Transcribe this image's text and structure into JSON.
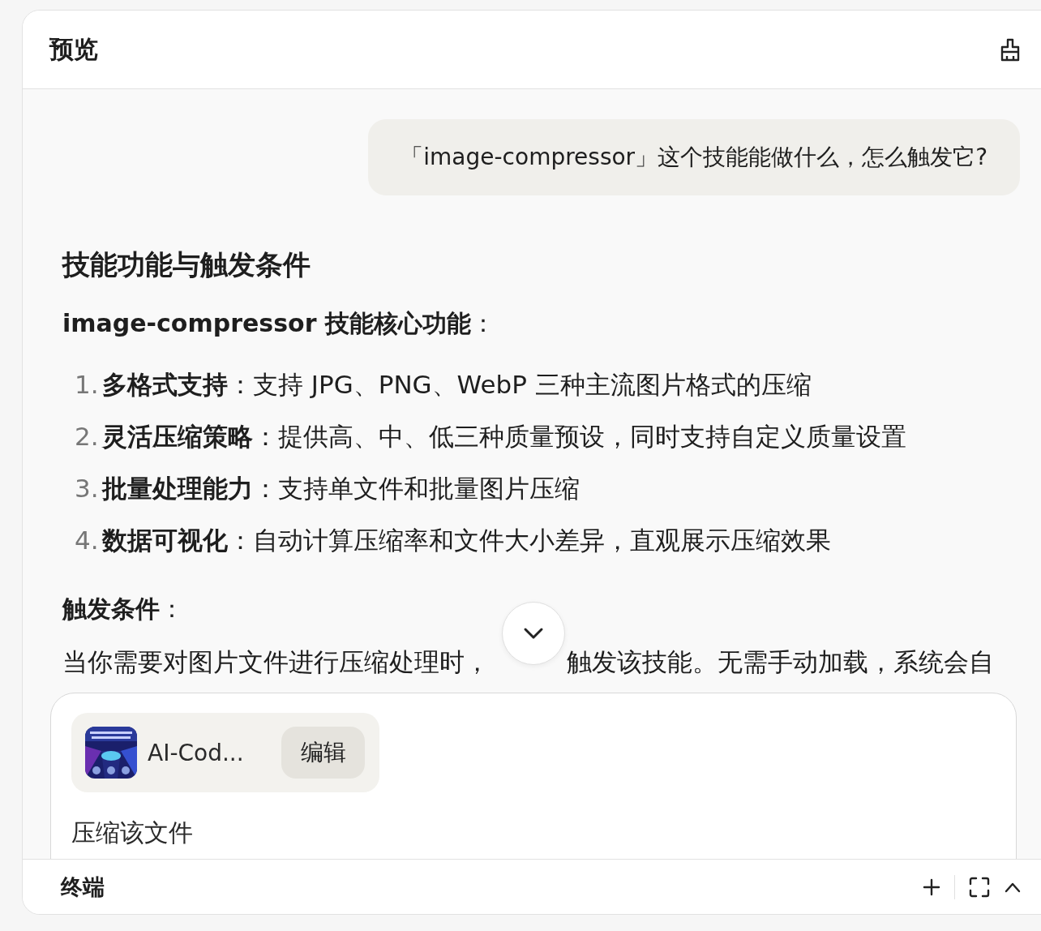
{
  "header": {
    "title": "预览"
  },
  "user_message": "「image-compressor」这个技能能做什么，怎么触发它?",
  "answer": {
    "heading": "技能功能与触发条件",
    "subheading": "**image-compressor 技能核心功能**：",
    "list": [
      {
        "number": "1.",
        "text": "**多格式支持**：支持 JPG、PNG、WebP 三种主流图片格式的压缩"
      },
      {
        "number": "2.",
        "text": "**灵活压缩策略**：提供高、中、低三种质量预设，同时支持自定义质量设置"
      },
      {
        "number": "3.",
        "text": "**批量处理能力**：支持单文件和批量图片压缩"
      },
      {
        "number": "4.",
        "text": "**数据可视化**：自动计算压缩率和文件大小差异，直观展示压缩效果"
      }
    ],
    "trigger_heading": "**触发条件**：",
    "trigger_text_parts": [
      "当你需要对图片文件进行压缩处理时，",
      "触发该技能。无需手动加载，系统会自"
    ]
  },
  "composer": {
    "attachment": {
      "kind": "picture",
      "name": "AI-Cod...",
      "edit_label": "编辑"
    },
    "value": "压缩该文件"
  },
  "terminal": {
    "title": "终端"
  }
}
